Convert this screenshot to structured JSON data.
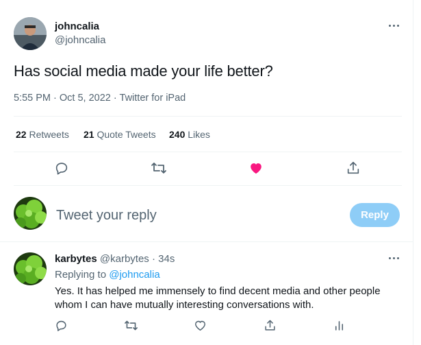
{
  "tweet": {
    "display_name": "johncalia",
    "handle": "@johncalia",
    "text": "Has social media made your life better?",
    "time": "5:55 PM",
    "sep1": "·",
    "date": "Oct 5, 2022",
    "sep2": "·",
    "source": "Twitter for iPad"
  },
  "stats": {
    "retweets_count": "22",
    "retweets_label": "Retweets",
    "quotes_count": "21",
    "quotes_label": "Quote Tweets",
    "likes_count": "240",
    "likes_label": "Likes"
  },
  "compose": {
    "placeholder": "Tweet your reply",
    "reply_button": "Reply"
  },
  "reply": {
    "display_name": "karbytes",
    "handle": "@karbytes",
    "sep": "·",
    "time": "34s",
    "replying_to_label": "Replying to",
    "replying_to_handle": "@johncalia",
    "text": "Yes. It has helped me immensely to find decent media and other people whom I can have mutually interesting conversations with."
  },
  "icons": {
    "comment": "comment-icon",
    "retweet": "retweet-icon",
    "like": "heart-icon",
    "share": "share-icon",
    "analytics": "analytics-icon",
    "more": "more-icon"
  },
  "colors": {
    "liked_heart": "#f91880",
    "link": "#1d9bf0",
    "reply_button_disabled": "#8ecdf7",
    "muted_text": "#536471"
  }
}
